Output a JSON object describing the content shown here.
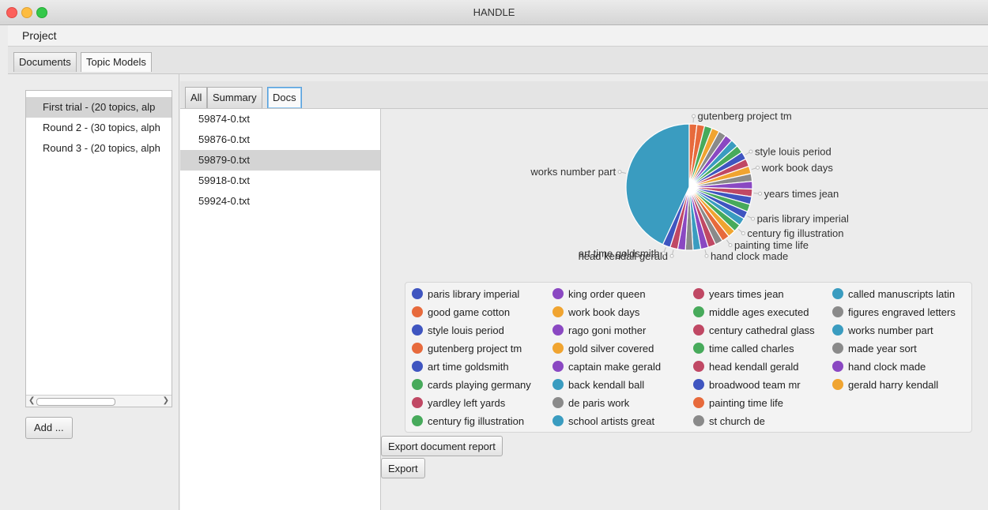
{
  "window": {
    "title": "HANDLE"
  },
  "menubar": {
    "items": [
      "Project"
    ]
  },
  "main_tabs": [
    {
      "label": "Documents"
    },
    {
      "label": "Topic Models"
    }
  ],
  "models": {
    "items": [
      {
        "label": "First trial - (20 topics, alp"
      },
      {
        "label": "Round 2 - (30 topics, alph"
      },
      {
        "label": "Round 3 - (20 topics, alph"
      }
    ],
    "add_label": "Add ..."
  },
  "sub_tabs": [
    {
      "label": "All"
    },
    {
      "label": "Summary"
    },
    {
      "label": "Docs"
    }
  ],
  "documents": [
    {
      "name": "59874-0.txt"
    },
    {
      "name": "59876-0.txt"
    },
    {
      "name": "59879-0.txt"
    },
    {
      "name": "59918-0.txt"
    },
    {
      "name": "59924-0.txt"
    }
  ],
  "buttons": {
    "export_report": "Export document report",
    "export": "Export"
  },
  "chart_data": {
    "type": "pie",
    "slices": [
      {
        "label": "works number part",
        "value": 44,
        "color": "#3a9cc0"
      },
      {
        "label": "gutenberg project tm",
        "value": 2,
        "color": "#e76a3c"
      },
      {
        "label": "good game cotton",
        "value": 2,
        "color": "#e76a3c"
      },
      {
        "label": "cards playing germany",
        "value": 2,
        "color": "#47aa5b"
      },
      {
        "label": "gold silver covered",
        "value": 2,
        "color": "#f0a430"
      },
      {
        "label": "figures engraved letters",
        "value": 2,
        "color": "#8a8a8a"
      },
      {
        "label": "rago goni mother",
        "value": 2,
        "color": "#8a48c2"
      },
      {
        "label": "school artists great",
        "value": 2,
        "color": "#3a9cc0"
      },
      {
        "label": "middle ages executed",
        "value": 2,
        "color": "#47aa5b"
      },
      {
        "label": "style louis period",
        "value": 2,
        "color": "#3f55c0"
      },
      {
        "label": "yardley left yards",
        "value": 2,
        "color": "#c04864"
      },
      {
        "label": "work book days",
        "value": 2,
        "color": "#f0a430"
      },
      {
        "label": "de paris work",
        "value": 2,
        "color": "#8a8a8a"
      },
      {
        "label": "captain make gerald",
        "value": 2,
        "color": "#8a48c2"
      },
      {
        "label": "years times jean",
        "value": 2,
        "color": "#c04864"
      },
      {
        "label": "broadwood team mr",
        "value": 2,
        "color": "#3f55c0"
      },
      {
        "label": "time called charles",
        "value": 2,
        "color": "#47aa5b"
      },
      {
        "label": "paris library imperial",
        "value": 2,
        "color": "#3f55c0"
      },
      {
        "label": "called manuscripts latin",
        "value": 2,
        "color": "#3a9cc0"
      },
      {
        "label": "century fig illustration",
        "value": 2,
        "color": "#47aa5b"
      },
      {
        "label": "gerald harry kendall",
        "value": 2,
        "color": "#f0a430"
      },
      {
        "label": "painting time life",
        "value": 2,
        "color": "#e76a3c"
      },
      {
        "label": "made year sort",
        "value": 2,
        "color": "#8a8a8a"
      },
      {
        "label": "century cathedral glass",
        "value": 2,
        "color": "#c04864"
      },
      {
        "label": "hand clock made",
        "value": 2,
        "color": "#8a48c2"
      },
      {
        "label": "back kendall ball",
        "value": 2,
        "color": "#3a9cc0"
      },
      {
        "label": "st church de",
        "value": 2,
        "color": "#8a8a8a"
      },
      {
        "label": "king order queen",
        "value": 2,
        "color": "#8a48c2"
      },
      {
        "label": "head kendall gerald",
        "value": 2,
        "color": "#c04864"
      },
      {
        "label": "art time goldsmith",
        "value": 2,
        "color": "#3f55c0"
      }
    ],
    "shown_labels": [
      "art time goldsmith",
      "head kendall gerald",
      "hand clock made",
      "painting time life",
      "century fig illustration",
      "paris library imperial",
      "years times jean",
      "work book days",
      "style louis period",
      "gutenberg project tm",
      "works number part"
    ],
    "legend": [
      {
        "label": "paris library imperial",
        "color": "#3f55c0"
      },
      {
        "label": "good game cotton",
        "color": "#e76a3c"
      },
      {
        "label": "style louis period",
        "color": "#3f55c0"
      },
      {
        "label": "gutenberg project tm",
        "color": "#e76a3c"
      },
      {
        "label": "art time goldsmith",
        "color": "#3f55c0"
      },
      {
        "label": "cards playing germany",
        "color": "#47aa5b"
      },
      {
        "label": "yardley left yards",
        "color": "#c04864"
      },
      {
        "label": "century fig illustration",
        "color": "#47aa5b"
      },
      {
        "label": "king order queen",
        "color": "#8a48c2"
      },
      {
        "label": "work book days",
        "color": "#f0a430"
      },
      {
        "label": "rago goni mother",
        "color": "#8a48c2"
      },
      {
        "label": "gold silver covered",
        "color": "#f0a430"
      },
      {
        "label": "captain make gerald",
        "color": "#8a48c2"
      },
      {
        "label": "back kendall ball",
        "color": "#3a9cc0"
      },
      {
        "label": "de paris work",
        "color": "#8a8a8a"
      },
      {
        "label": "school artists great",
        "color": "#3a9cc0"
      },
      {
        "label": "years times jean",
        "color": "#c04864"
      },
      {
        "label": "middle ages executed",
        "color": "#47aa5b"
      },
      {
        "label": "century cathedral glass",
        "color": "#c04864"
      },
      {
        "label": "time called charles",
        "color": "#47aa5b"
      },
      {
        "label": "head kendall gerald",
        "color": "#c04864"
      },
      {
        "label": "broadwood team mr",
        "color": "#3f55c0"
      },
      {
        "label": "painting time life",
        "color": "#e76a3c"
      },
      {
        "label": "st church de",
        "color": "#8a8a8a"
      },
      {
        "label": "called manuscripts latin",
        "color": "#3a9cc0"
      },
      {
        "label": "figures engraved letters",
        "color": "#8a8a8a"
      },
      {
        "label": "works number part",
        "color": "#3a9cc0"
      },
      {
        "label": "made year sort",
        "color": "#8a8a8a"
      },
      {
        "label": "hand clock made",
        "color": "#8a48c2"
      },
      {
        "label": "gerald harry kendall",
        "color": "#f0a430"
      }
    ]
  }
}
